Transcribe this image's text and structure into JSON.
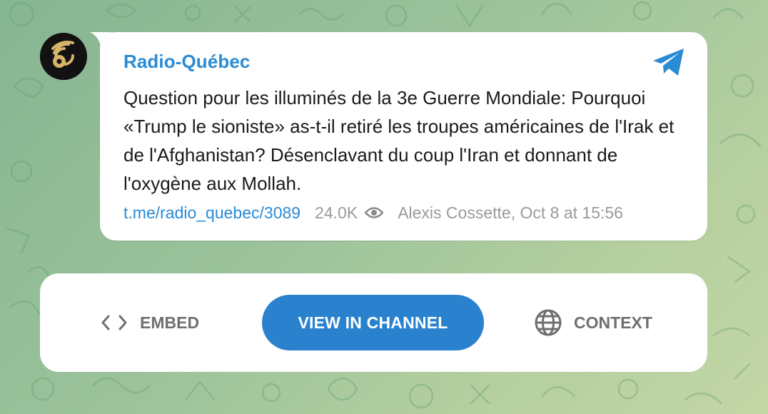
{
  "post": {
    "channel_name": "Radio-Québec",
    "text": "Question pour les illuminés de la 3e Guerre Mondiale: Pourquoi «Trump le sioniste» as-t-il retiré les troupes américaines de l'Irak et de l'Afghanistan? Désenclavant du coup l'Iran et donnant de l'oxygène aux Mollah.",
    "link": "t.me/radio_quebec/3089",
    "views": "24.0K",
    "author_date": "Alexis Cossette, Oct 8 at 15:56"
  },
  "actions": {
    "embed_label": "EMBED",
    "view_label": "VIEW IN CHANNEL",
    "context_label": "CONTEXT"
  },
  "icons": {
    "avatar": "radio-signal-avatar",
    "platform": "telegram-icon",
    "views": "eye-icon",
    "embed": "code-icon",
    "context": "globe-icon"
  },
  "colors": {
    "accent": "#2a8bd5",
    "button": "#2a82cf",
    "muted": "#9a9a9a",
    "background": "#9cc39b"
  }
}
